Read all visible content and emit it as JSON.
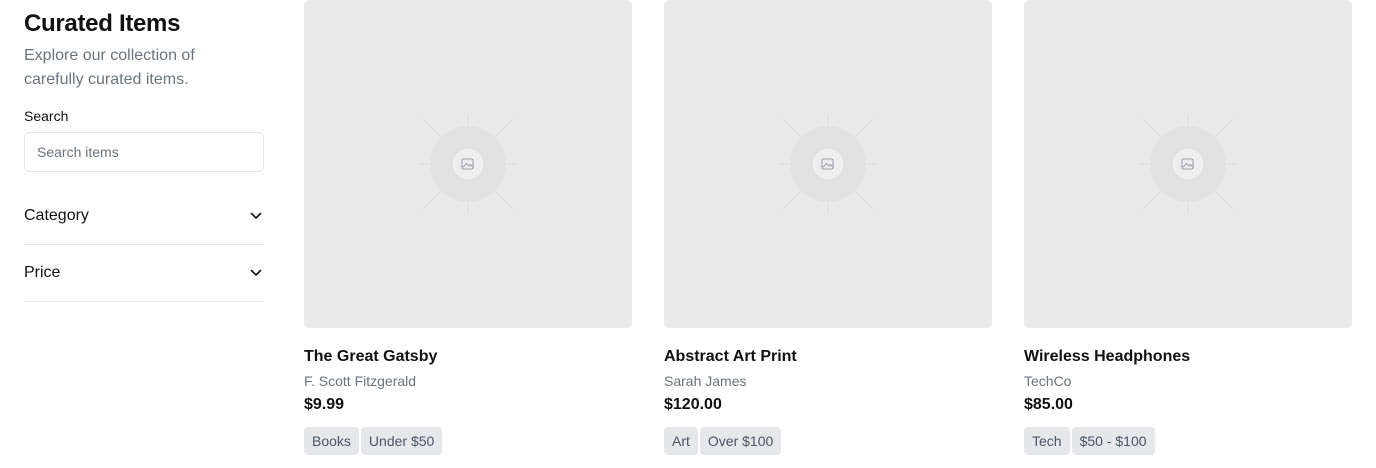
{
  "sidebar": {
    "title": "Curated Items",
    "subtitle": "Explore our collection of carefully curated items.",
    "search": {
      "label": "Search",
      "placeholder": "Search items"
    },
    "filters": [
      {
        "label": "Category",
        "icon": "chevron-down-icon"
      },
      {
        "label": "Price",
        "icon": "chevron-down-icon"
      }
    ]
  },
  "items": [
    {
      "title": "The Great Gatsby",
      "author": "F. Scott Fitzgerald",
      "price": "$9.99",
      "tags": [
        "Books",
        "Under $50"
      ]
    },
    {
      "title": "Abstract Art Print",
      "author": "Sarah James",
      "price": "$120.00",
      "tags": [
        "Art",
        "Over $100"
      ]
    },
    {
      "title": "Wireless Headphones",
      "author": "TechCo",
      "price": "$85.00",
      "tags": [
        "Tech",
        "$50 - $100"
      ]
    }
  ],
  "colors": {
    "text": "#111111",
    "muted": "#6b7280",
    "placeholder_bg": "#e9e9e9",
    "tag_bg": "#e5e7eb",
    "border": "#e5e7eb"
  },
  "icons": {
    "image_placeholder": "image-placeholder-icon",
    "chevron": "chevron-down-icon"
  }
}
